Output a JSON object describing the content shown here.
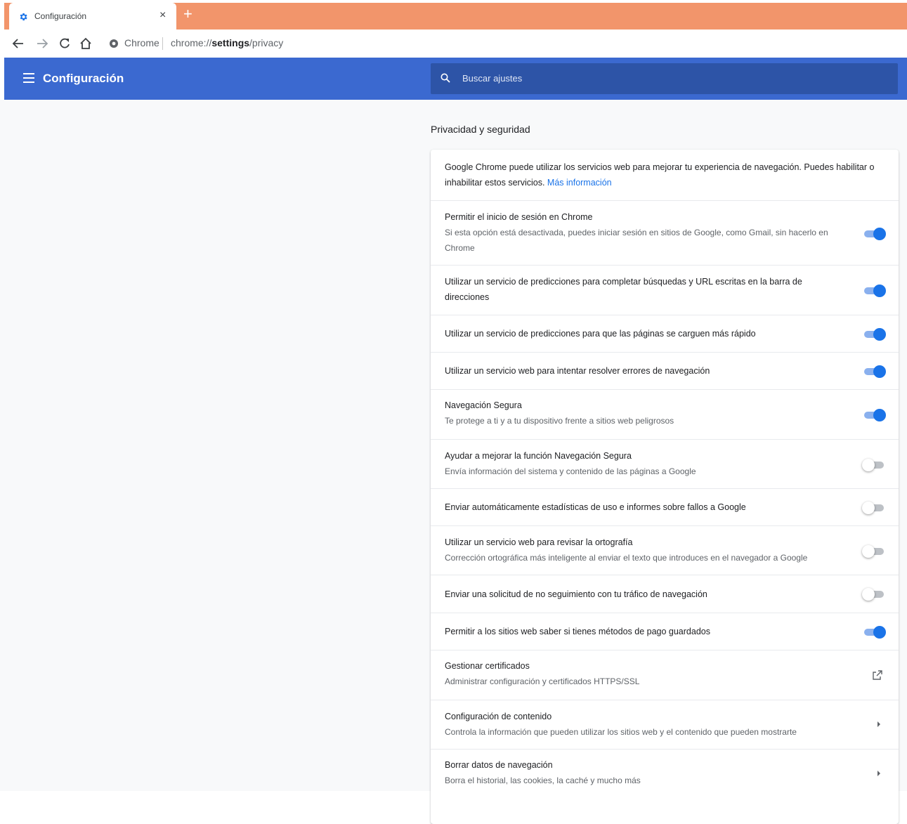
{
  "browser": {
    "tab_title": "Configuración",
    "close_glyph": "×",
    "newtab_glyph": "+",
    "omnibox_chip": "Chrome",
    "url_prefix": "chrome://",
    "url_host": "settings",
    "url_path": "/privacy",
    "tab_strip_color": "#f2956b"
  },
  "header": {
    "title": "Configuración",
    "search_placeholder": "Buscar ajustes",
    "color": "#3b69d0"
  },
  "section": {
    "title": "Privacidad y seguridad",
    "intro": "Google Chrome puede utilizar los servicios web para mejorar tu experiencia de navegación. Puedes habilitar o inhabilitar estos servicios.",
    "intro_link": "Más información"
  },
  "rows": [
    {
      "label": "Permitir el inicio de sesión en Chrome",
      "sub": "Si esta opción está desactivada, puedes iniciar sesión en sitios de Google, como Gmail, sin hacerlo en Chrome",
      "control": "toggle",
      "checked": true
    },
    {
      "label": "Utilizar un servicio de predicciones para completar búsquedas y URL escritas en la barra de direcciones",
      "sub": "",
      "control": "toggle",
      "checked": true
    },
    {
      "label": "Utilizar un servicio de predicciones para que las páginas se carguen más rápido",
      "sub": "",
      "control": "toggle",
      "checked": true
    },
    {
      "label": "Utilizar un servicio web para intentar resolver errores de navegación",
      "sub": "",
      "control": "toggle",
      "checked": true
    },
    {
      "label": "Navegación Segura",
      "sub": "Te protege a ti y a tu dispositivo frente a sitios web peligrosos",
      "control": "toggle",
      "checked": true
    },
    {
      "label": "Ayudar a mejorar la función Navegación Segura",
      "sub": "Envía información del sistema y contenido de las páginas a Google",
      "control": "toggle",
      "checked": false
    },
    {
      "label": "Enviar automáticamente estadísticas de uso e informes sobre fallos a Google",
      "sub": "",
      "control": "toggle",
      "checked": false
    },
    {
      "label": "Utilizar un servicio web para revisar la ortografía",
      "sub": "Corrección ortográfica más inteligente al enviar el texto que introduces en el navegador a Google",
      "control": "toggle",
      "checked": false
    },
    {
      "label": "Enviar una solicitud de no seguimiento con tu tráfico de navegación",
      "sub": "",
      "control": "toggle",
      "checked": false
    },
    {
      "label": "Permitir a los sitios web saber si tienes métodos de pago guardados",
      "sub": "",
      "control": "toggle",
      "checked": true
    },
    {
      "label": "Gestionar certificados",
      "sub": "Administrar configuración y certificados HTTPS/SSL",
      "control": "external-link-icon",
      "checked": null
    },
    {
      "label": "Configuración de contenido",
      "sub": "Controla la información que pueden utilizar los sitios web y el contenido que pueden mostrarte",
      "control": "arrow-right-icon",
      "checked": null
    },
    {
      "label": "Borrar datos de navegación",
      "sub": "Borra el historial, las cookies, la caché y mucho más",
      "control": "arrow-right-icon",
      "checked": null
    }
  ]
}
